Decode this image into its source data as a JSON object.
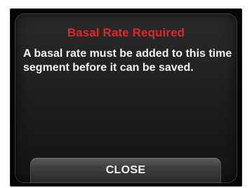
{
  "dialog": {
    "title": "Basal Rate Required",
    "message": "A basal rate must be added to this time segment before it can be saved.",
    "close_label": "CLOSE"
  },
  "colors": {
    "title": "#e0262b",
    "text": "#f2f2f2",
    "background": "#050505"
  }
}
